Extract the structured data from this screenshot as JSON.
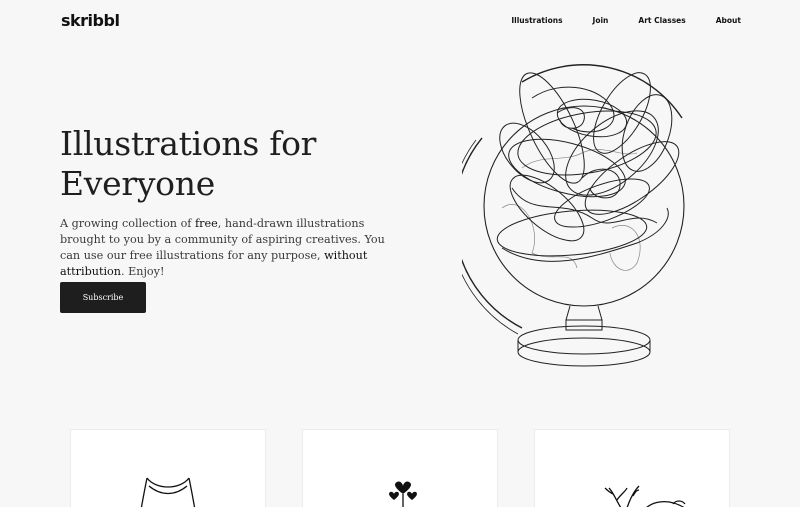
{
  "header": {
    "logo": "skribbl",
    "nav": [
      {
        "label": "Illustrations"
      },
      {
        "label": "Join"
      },
      {
        "label": "Art Classes"
      },
      {
        "label": "About"
      }
    ]
  },
  "hero": {
    "title": "Illustrations for Everyone",
    "desc": {
      "p1": "A growing collection of ",
      "free": "free",
      "p2": ", hand-drawn illustrations brought to you by a community of aspiring creatives. You can use our free illustrations for any purpose, ",
      "noattr": "without attribution",
      "p3": ". Enjoy!"
    },
    "subscribe_label": "Subscribe"
  },
  "colors": {
    "background": "#f7f7f7",
    "text": "#1c1c1c",
    "button": "#1e1e1e",
    "card": "#ffffff"
  },
  "icons": [
    "globe-illustration",
    "figure-illustration",
    "hearts-illustration",
    "deer-illustration"
  ]
}
